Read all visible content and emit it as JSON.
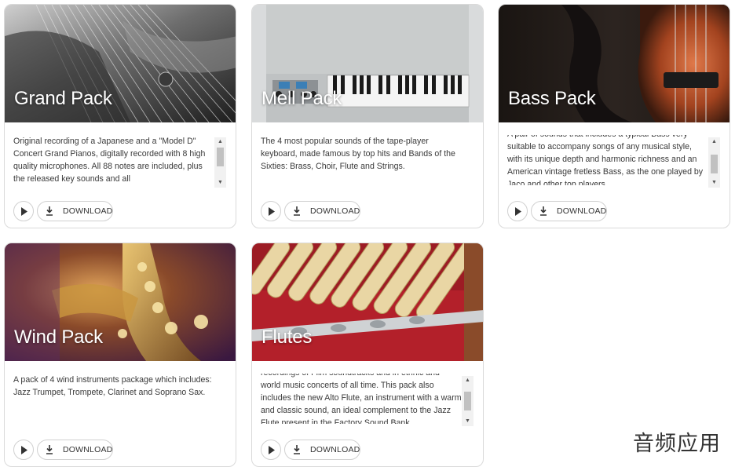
{
  "cards": [
    {
      "title": "Grand Pack",
      "description": "Original recording of a Japanese and a \"Model D\" Concert Grand Pianos, digitally recorded with 8 high quality microphones. All 88 notes are included, plus the released key sounds and all",
      "has_scrollbar": true,
      "download_label": "DOWNLOAD"
    },
    {
      "title": "Mell Pack",
      "description": "The 4 most popular sounds of the tape-player keyboard, made famous by top hits and Bands of the Sixties: Brass, Choir, Flute and Strings.",
      "has_scrollbar": false,
      "download_label": "DOWNLOAD"
    },
    {
      "title": "Bass Pack",
      "description": "A pair of sounds that includes a typical Bass very suitable to accompany songs of any musical style, with its unique depth and harmonic richness and an American vintage fretless Bass, as the one played by Jaco and other top players.",
      "has_scrollbar": true,
      "download_label": "DOWNLOAD"
    },
    {
      "title": "Wind Pack",
      "description": "A pack of 4 wind instruments package which includes: Jazz Trumpet, Trompete, Clarinet and Soprano Sax.",
      "has_scrollbar": false,
      "download_label": "DOWNLOAD"
    },
    {
      "title": "Flutes",
      "description": "recordings of Film soundtracks and in ethnic and world music concerts of all time. This pack also includes the new Alto Flute, an instrument with a warm and classic sound, an ideal complement to the Jazz Flute present in the Factory Sound Bank",
      "has_scrollbar": true,
      "download_label": "DOWNLOAD"
    }
  ],
  "icons": {
    "play": "play-icon",
    "download": "download-icon",
    "scroll_up": "scroll-up-arrow-icon",
    "scroll_down": "scroll-down-arrow-icon"
  },
  "watermark": "音频应用"
}
